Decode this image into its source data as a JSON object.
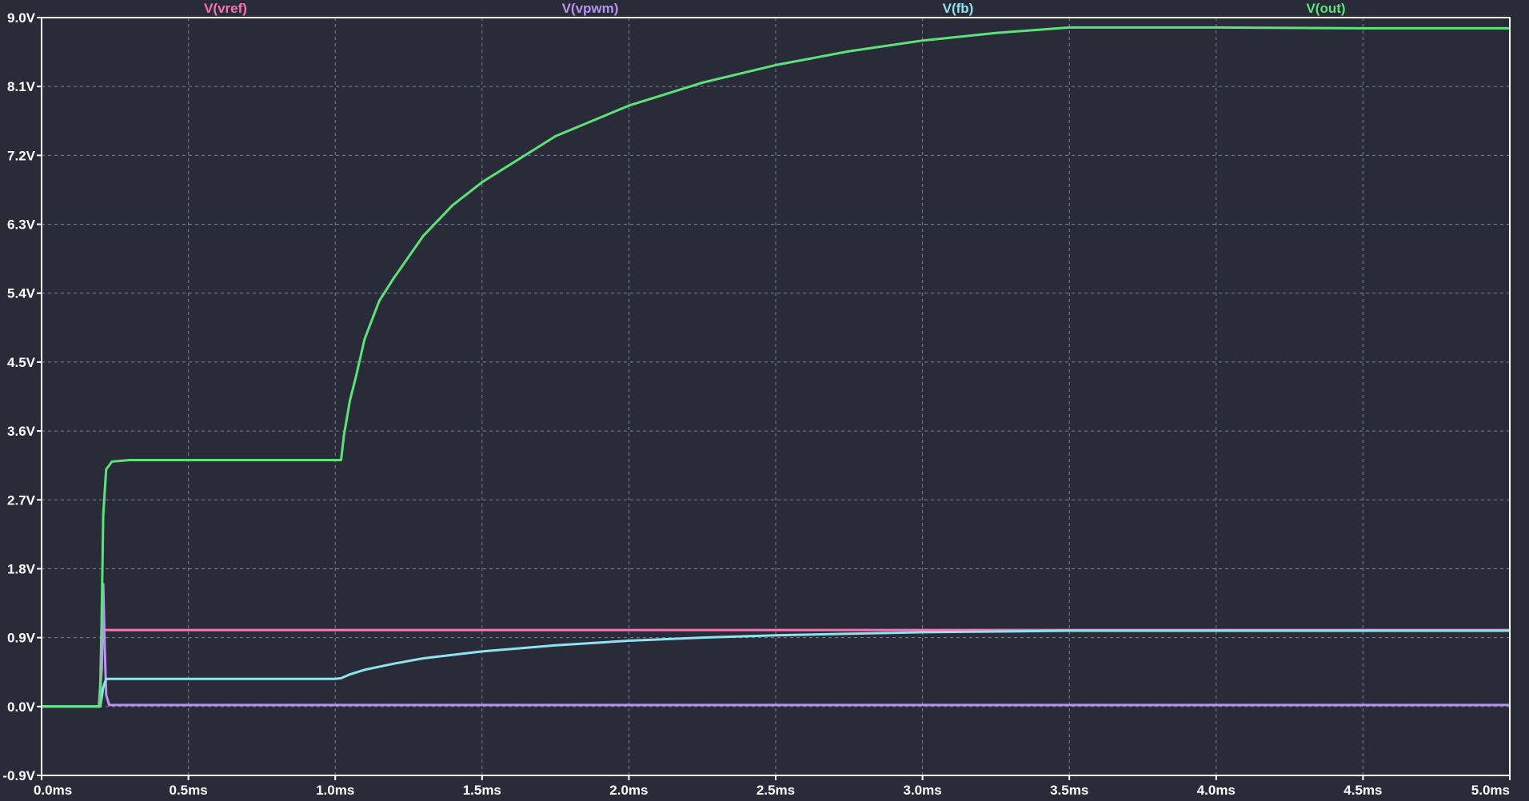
{
  "chart_data": {
    "type": "line",
    "title": "",
    "xlabel": "",
    "ylabel": "",
    "xlim": [
      0,
      5.0
    ],
    "ylim": [
      -0.9,
      9.0
    ],
    "grid": true,
    "legend_placement": "top",
    "x_ticks": [
      {
        "value": 0.0,
        "label": "0.0ms"
      },
      {
        "value": 0.5,
        "label": "0.5ms"
      },
      {
        "value": 1.0,
        "label": "1.0ms"
      },
      {
        "value": 1.5,
        "label": "1.5ms"
      },
      {
        "value": 2.0,
        "label": "2.0ms"
      },
      {
        "value": 2.5,
        "label": "2.5ms"
      },
      {
        "value": 3.0,
        "label": "3.0ms"
      },
      {
        "value": 3.5,
        "label": "3.5ms"
      },
      {
        "value": 4.0,
        "label": "4.0ms"
      },
      {
        "value": 4.5,
        "label": "4.5ms"
      },
      {
        "value": 5.0,
        "label": "5.0ms"
      }
    ],
    "y_ticks": [
      {
        "value": 9.0,
        "label": "9.0V"
      },
      {
        "value": 8.1,
        "label": "8.1V"
      },
      {
        "value": 7.2,
        "label": "7.2V"
      },
      {
        "value": 6.3,
        "label": "6.3V"
      },
      {
        "value": 5.4,
        "label": "5.4V"
      },
      {
        "value": 4.5,
        "label": "4.5V"
      },
      {
        "value": 3.6,
        "label": "3.6V"
      },
      {
        "value": 2.7,
        "label": "2.7V"
      },
      {
        "value": 1.8,
        "label": "1.8V"
      },
      {
        "value": 0.9,
        "label": "0.9V"
      },
      {
        "value": 0.0,
        "label": "0.0V"
      },
      {
        "value": -0.9,
        "label": "-0.9V"
      }
    ],
    "series": [
      {
        "name": "V(vref)",
        "color": "#ff6fb5",
        "x": [
          0.0,
          0.195,
          0.2,
          0.205,
          0.21,
          0.215,
          0.22,
          0.25,
          1.0,
          2.0,
          3.0,
          4.0,
          5.0
        ],
        "y": [
          0.0,
          0.0,
          0.3,
          1.2,
          0.95,
          1.0,
          1.0,
          1.0,
          1.0,
          1.0,
          1.0,
          1.0,
          1.0
        ]
      },
      {
        "name": "V(vpwm)",
        "color": "#b894f2",
        "x": [
          0.0,
          0.195,
          0.205,
          0.21,
          0.215,
          0.22,
          0.23,
          1.0,
          2.0,
          3.0,
          4.0,
          5.0
        ],
        "y": [
          0.0,
          0.0,
          0.5,
          1.6,
          0.8,
          0.15,
          0.02,
          0.02,
          0.02,
          0.02,
          0.02,
          0.02
        ]
      },
      {
        "name": "V(fb)",
        "color": "#8fe3f0",
        "x": [
          0.0,
          0.2,
          0.21,
          0.22,
          0.3,
          1.0,
          1.02,
          1.05,
          1.1,
          1.2,
          1.3,
          1.5,
          1.75,
          2.0,
          2.25,
          2.5,
          2.75,
          3.0,
          3.25,
          3.5,
          4.0,
          4.5,
          5.0
        ],
        "y": [
          0.0,
          0.0,
          0.25,
          0.36,
          0.36,
          0.36,
          0.37,
          0.42,
          0.48,
          0.56,
          0.63,
          0.72,
          0.8,
          0.86,
          0.9,
          0.93,
          0.95,
          0.97,
          0.98,
          0.99,
          0.99,
          0.99,
          0.99
        ]
      },
      {
        "name": "V(out)",
        "color": "#5be37a",
        "x": [
          0.0,
          0.2,
          0.21,
          0.22,
          0.24,
          0.3,
          0.5,
          1.02,
          1.03,
          1.05,
          1.07,
          1.1,
          1.15,
          1.2,
          1.3,
          1.4,
          1.5,
          1.75,
          2.0,
          2.25,
          2.5,
          2.75,
          3.0,
          3.25,
          3.5,
          4.0,
          4.5,
          5.0
        ],
        "y": [
          0.0,
          0.0,
          2.5,
          3.1,
          3.2,
          3.22,
          3.22,
          3.22,
          3.55,
          4.0,
          4.3,
          4.8,
          5.3,
          5.6,
          6.15,
          6.55,
          6.85,
          7.45,
          7.85,
          8.15,
          8.38,
          8.56,
          8.7,
          8.8,
          8.87,
          8.87,
          8.86,
          8.86
        ]
      }
    ]
  },
  "colors": {
    "background": "#2a2b38",
    "axis": "#ffffff",
    "grid": "#7a7f9a"
  }
}
